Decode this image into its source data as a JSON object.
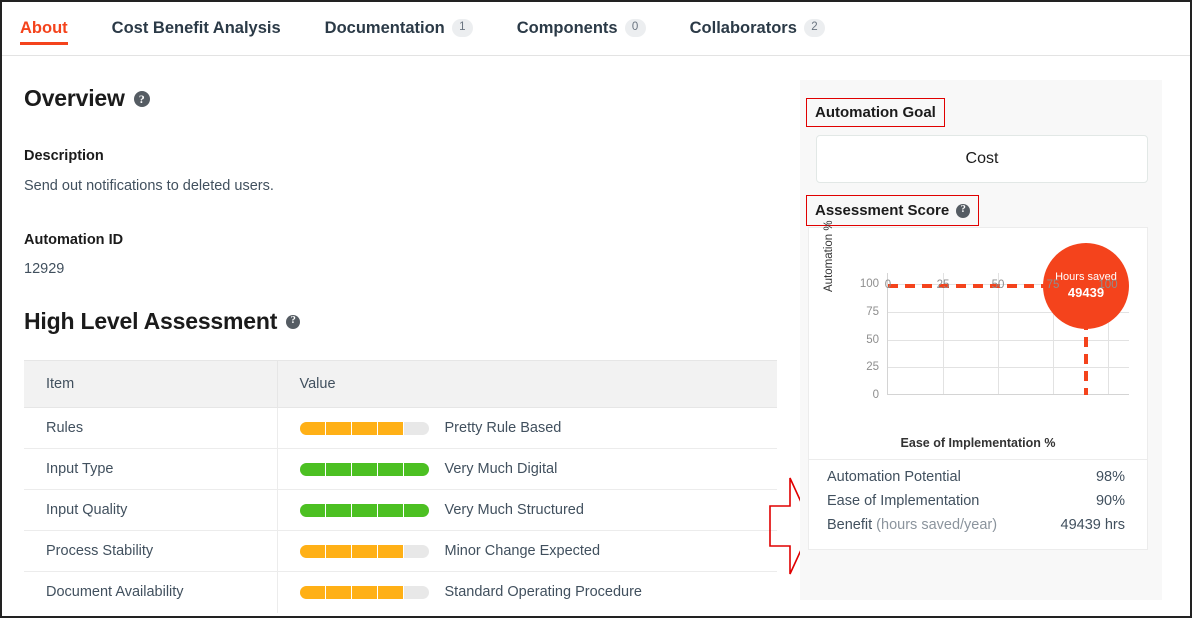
{
  "tabs": [
    {
      "label": "About",
      "badge": null,
      "active": true
    },
    {
      "label": "Cost Benefit Analysis",
      "badge": null,
      "active": false
    },
    {
      "label": "Documentation",
      "badge": "1",
      "active": false
    },
    {
      "label": "Components",
      "badge": "0",
      "active": false
    },
    {
      "label": "Collaborators",
      "badge": "2",
      "active": false
    }
  ],
  "overview": {
    "title": "Overview",
    "help_glyph": "?",
    "description_label": "Description",
    "description_value": "Send out notifications to deleted users.",
    "automation_id_label": "Automation ID",
    "automation_id_value": "12929"
  },
  "high_level_assessment": {
    "title": "High Level Assessment",
    "help_glyph": "?",
    "columns": [
      "Item",
      "Value"
    ],
    "rows": [
      {
        "item": "Rules",
        "filled": 4,
        "total": 5,
        "color": "orange",
        "value": "Pretty Rule Based"
      },
      {
        "item": "Input Type",
        "filled": 5,
        "total": 5,
        "color": "green",
        "value": "Very Much Digital"
      },
      {
        "item": "Input Quality",
        "filled": 5,
        "total": 5,
        "color": "green",
        "value": "Very Much Structured"
      },
      {
        "item": "Process Stability",
        "filled": 4,
        "total": 5,
        "color": "orange",
        "value": "Minor Change Expected"
      },
      {
        "item": "Document Availability",
        "filled": 4,
        "total": 5,
        "color": "orange",
        "value": "Standard Operating Procedure"
      }
    ]
  },
  "right_panel": {
    "automation_goal_label": "Automation Goal",
    "automation_goal_value": "Cost",
    "assessment_score_label": "Assessment Score",
    "help_glyph": "?",
    "stats": [
      {
        "label": "Automation Potential",
        "sub": "",
        "value": "98%"
      },
      {
        "label": "Ease of Implementation",
        "sub": "",
        "value": "90%"
      },
      {
        "label": "Benefit",
        "sub": "(hours saved/year)",
        "value": "49439 hrs"
      }
    ]
  },
  "chart_data": {
    "type": "scatter",
    "title": "",
    "xlabel": "Ease of Implementation %",
    "ylabel": "Automation %",
    "xlim": [
      0,
      110
    ],
    "ylim": [
      0,
      110
    ],
    "xticks": [
      0,
      25,
      50,
      75,
      100
    ],
    "yticks": [
      0,
      25,
      50,
      75,
      100
    ],
    "grid": true,
    "legend": "none",
    "points": [
      {
        "x": 90,
        "y": 98,
        "bubble_label_line1": "Hours saved",
        "bubble_label_line2": "49439",
        "size": "large",
        "color": "#f4431c"
      }
    ],
    "annotations": [
      {
        "type": "hline",
        "y": 98,
        "style": "dashed",
        "color": "#f4431c"
      },
      {
        "type": "vline",
        "x": 90,
        "style": "dashed",
        "color": "#f4431c"
      }
    ]
  },
  "colors": {
    "accent": "#f4431c",
    "orange_bar": "#ffb016",
    "green_bar": "#4cc022",
    "bar_track": "#e8e8e8",
    "annotation_red": "#e00000",
    "panel_bg": "#f8f8f8"
  }
}
